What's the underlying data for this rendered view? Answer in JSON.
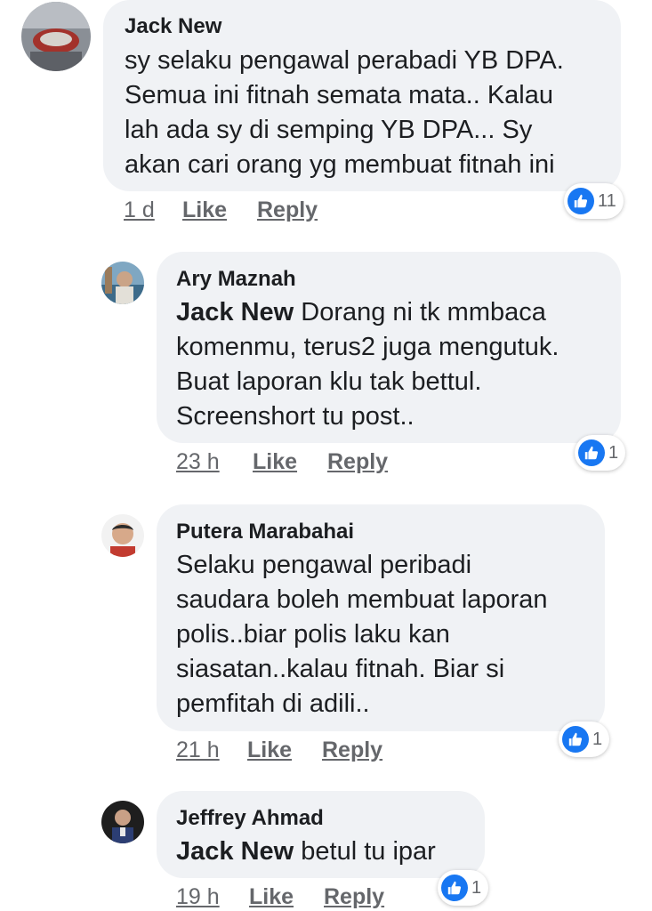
{
  "colors": {
    "like_blue": "#1877f2",
    "bubble": "#f0f2f5",
    "meta": "#65676b"
  },
  "comments": [
    {
      "author": "Jack New",
      "lines": [
        "sy selaku pengawal perabadi YB DPA.",
        "Semua ini fitnah semata mata.. Kalau",
        "lah ada sy di semping YB DPA... Sy",
        "akan cari orang yg membuat fitnah ini"
      ],
      "time": "1 d",
      "like": "Like",
      "reply": "Reply",
      "reactions": "11",
      "reaction_icon": "like-icon"
    },
    {
      "author": "Ary Maznah",
      "mention": "Jack New",
      "lines": [
        " Dorang ni tk mmbaca",
        "komenmu, terus2 juga mengutuk.",
        "Buat laporan klu tak bettul.",
        "Screenshort tu post.."
      ],
      "time": "23 h",
      "like": "Like",
      "reply": "Reply",
      "reactions": "1",
      "reaction_icon": "like-icon"
    },
    {
      "author": "Putera Marabahai",
      "lines": [
        "Selaku pengawal peribadi",
        "saudara boleh membuat laporan",
        "polis..biar polis laku kan",
        "siasatan..kalau fitnah. Biar si",
        "pemfitah di adili.."
      ],
      "time": "21 h",
      "like": "Like",
      "reply": "Reply",
      "reactions": "1",
      "reaction_icon": "like-icon"
    },
    {
      "author": "Jeffrey Ahmad",
      "mention": "Jack New",
      "lines": [
        " betul tu ipar"
      ],
      "time": "19 h",
      "like": "Like",
      "reply": "Reply",
      "reactions": "1",
      "reaction_icon": "like-icon"
    }
  ]
}
